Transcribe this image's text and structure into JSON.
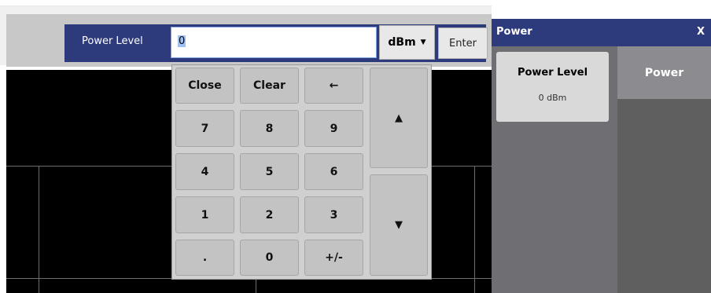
{
  "entry": {
    "label": "Power Level",
    "value": "0",
    "unit": "dBm",
    "enter_label": "Enter"
  },
  "keypad": {
    "close": "Close",
    "clear": "Clear",
    "backspace": "←",
    "up": "▲",
    "down": "▼",
    "k7": "7",
    "k8": "8",
    "k9": "9",
    "k4": "4",
    "k5": "5",
    "k6": "6",
    "k1": "1",
    "k2": "2",
    "k3": "3",
    "dot": ".",
    "k0": "0",
    "sign": "+/-"
  },
  "panel": {
    "title": "Power",
    "close": "X",
    "softkey_label": "Power Level",
    "softkey_value": "0 dBm",
    "tab_label": "Power"
  },
  "icons": {
    "unit_dropdown": "caret-down-icon"
  }
}
